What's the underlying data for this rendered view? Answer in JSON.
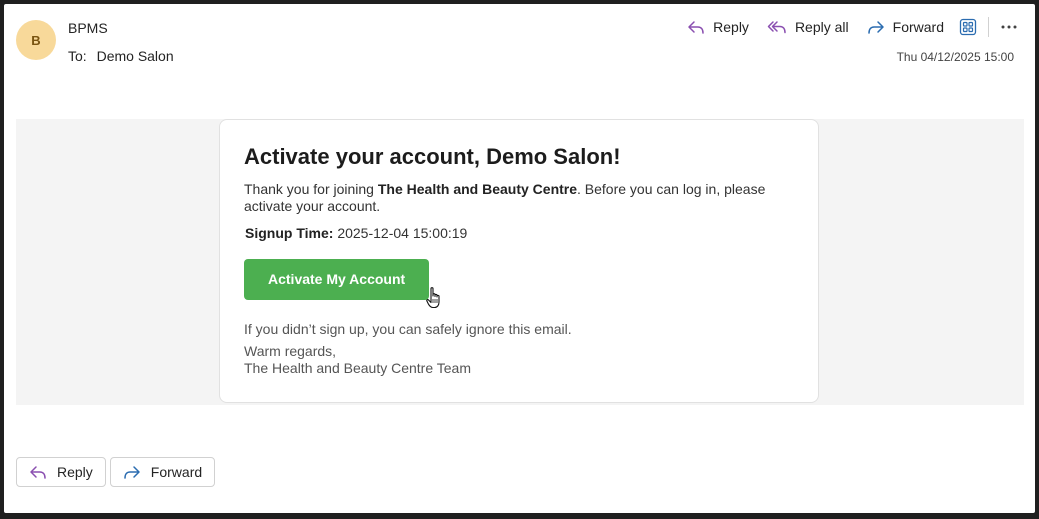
{
  "header": {
    "avatar_initial": "B",
    "sender_name": "BPMS",
    "to_label": "To:",
    "to_value": "Demo Salon",
    "timestamp": "Thu 04/12/2025 15:00"
  },
  "toolbar": {
    "reply_label": "Reply",
    "reply_all_label": "Reply all",
    "forward_label": "Forward",
    "apps_icon": "apps-grid-icon",
    "more_icon": "more-horizontal-icon"
  },
  "email": {
    "title": "Activate your account, Demo Salon!",
    "intro_prefix": "Thank you for joining ",
    "business_name": "The Health and Beauty Centre",
    "intro_suffix": ". Before you can log in, please activate your account.",
    "signup_label": "Signup Time:",
    "signup_value": "2025-12-04 15:00:19",
    "activate_button": "Activate My Account",
    "ignore_text": "If you didn’t sign up, you can safely ignore this email.",
    "regards_line": "Warm regards,",
    "team_line": "The Health and Beauty Centre Team"
  },
  "footer": {
    "reply_label": "Reply",
    "forward_label": "Forward"
  },
  "colors": {
    "accent_reply": "#8a4fb0",
    "accent_forward": "#2b6cb0",
    "button_green": "#4caf50",
    "avatar_bg": "#f8d99a"
  }
}
